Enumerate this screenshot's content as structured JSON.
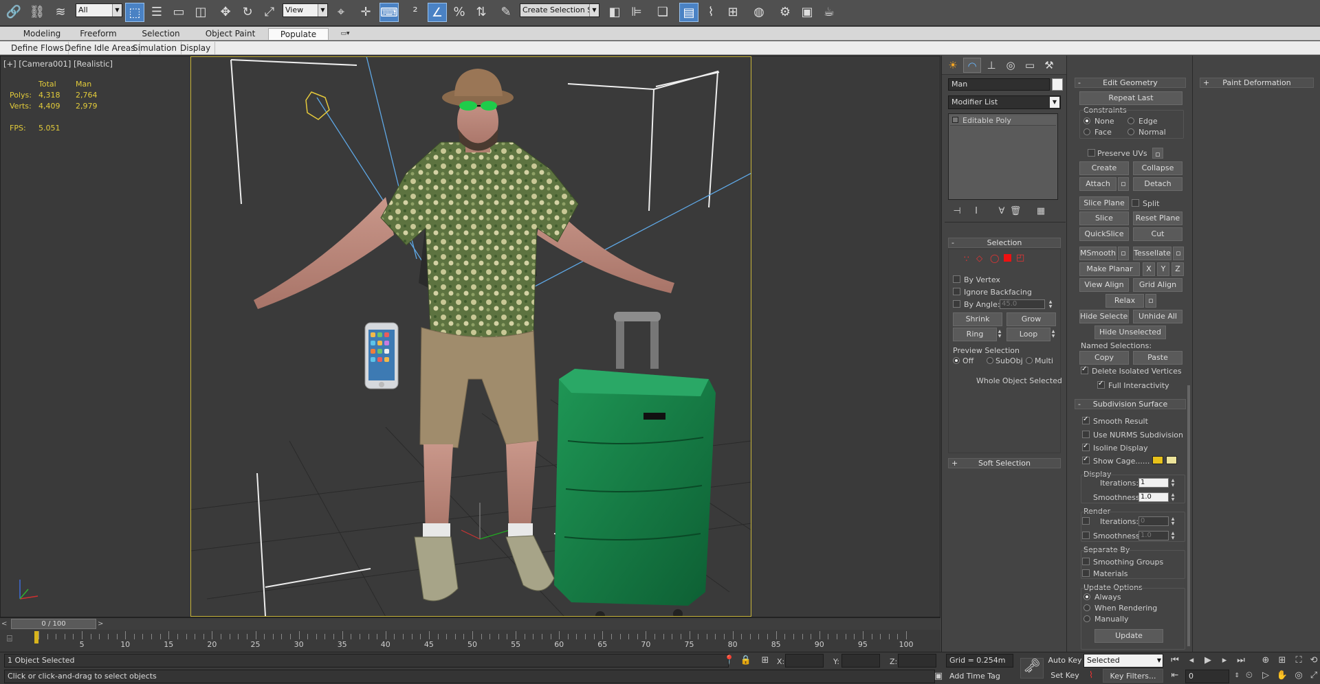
{
  "toolbar": {
    "selection_filter": "All",
    "ref_coord": "View",
    "named_selection_placeholder": "Create Selection Se",
    "colors": {
      "active": "#4a82c4",
      "bg": "#505050"
    }
  },
  "ribbon": {
    "tabs": [
      "Modeling",
      "Freeform",
      "Selection",
      "Object Paint",
      "Populate"
    ],
    "active_tab": "Populate",
    "subtabs": [
      "Define Flows",
      "Define Idle Areas",
      "Simulation",
      "Display"
    ]
  },
  "viewport": {
    "label": "[+] [Camera001] [Realistic]",
    "stats": {
      "col_total": "Total",
      "col_obj": "Man",
      "polys_label": "Polys:",
      "polys_total": "4,318",
      "polys_obj": "2,764",
      "verts_label": "Verts:",
      "verts_total": "4,409",
      "verts_obj": "2,979",
      "fps_label": "FPS:",
      "fps_value": "5.051"
    },
    "scene_objects": [
      "tourist-man-figure",
      "green-suitcase",
      "smartphone",
      "camera-frustum-lines",
      "ground-grid"
    ],
    "colors": {
      "frame": "#c8b53a",
      "stats": "#e3cc3a"
    }
  },
  "timeline": {
    "frame_display": "0 / 100",
    "ticks": [
      "5",
      "10",
      "15",
      "20",
      "25",
      "30",
      "35",
      "40",
      "45",
      "50",
      "55",
      "60",
      "65",
      "70",
      "75",
      "80",
      "85",
      "90",
      "95",
      "100"
    ]
  },
  "status": {
    "selected_text": "1 Object Selected",
    "prompt_text": "Click or click-and-drag to select objects",
    "x_label": "X:",
    "y_label": "Y:",
    "z_label": "Z:",
    "grid_text": "Grid = 0.254m",
    "add_time_tag": "Add Time Tag",
    "auto_key": "Auto Key",
    "set_key": "Set Key",
    "key_mode": "Selected",
    "key_filters": "Key Filters...",
    "frame_value": "0"
  },
  "command_panel": {
    "object_name": "Man",
    "modifier_list": "Modifier List",
    "stack_item": "Editable Poly",
    "selection": {
      "title": "Selection",
      "by_vertex": "By Vertex",
      "ignore_backfacing": "Ignore Backfacing",
      "by_angle": "By Angle:",
      "by_angle_value": "45.0",
      "shrink": "Shrink",
      "grow": "Grow",
      "ring": "Ring",
      "loop": "Loop",
      "preview_label": "Preview Selection",
      "preview_off": "Off",
      "preview_subobj": "SubObj",
      "preview_multi": "Multi",
      "whole_object": "Whole Object Selected"
    },
    "soft_selection": "Soft Selection"
  },
  "edit_geometry": {
    "title": "Edit Geometry",
    "repeat_last": "Repeat Last",
    "constraints": "Constraints",
    "none": "None",
    "edge": "Edge",
    "face": "Face",
    "normal": "Normal",
    "preserve_uvs": "Preserve UVs",
    "create": "Create",
    "collapse": "Collapse",
    "attach": "Attach",
    "detach": "Detach",
    "slice_plane": "Slice Plane",
    "split": "Split",
    "slice": "Slice",
    "reset_plane": "Reset Plane",
    "quickslice": "QuickSlice",
    "cut": "Cut",
    "msmooth": "MSmooth",
    "tessellate": "Tessellate",
    "make_planar": "Make Planar",
    "x": "X",
    "y": "Y",
    "z": "Z",
    "view_align": "View Align",
    "grid_align": "Grid Align",
    "relax": "Relax",
    "hide_selected": "Hide Selected",
    "unhide_all": "Unhide All",
    "hide_unselected": "Hide Unselected",
    "named_selections": "Named Selections:",
    "copy": "Copy",
    "paste": "Paste",
    "delete_isolated": "Delete Isolated Vertices",
    "full_interactivity": "Full Interactivity"
  },
  "subdivision": {
    "title": "Subdivision Surface",
    "smooth_result": "Smooth Result",
    "use_nurms": "Use NURMS Subdivision",
    "isoline_display": "Isoline Display",
    "show_cage": "Show Cage......",
    "display_label": "Display",
    "iterations_label": "Iterations:",
    "iterations_value": "1",
    "smoothness_label": "Smoothness:",
    "smoothness_value": "1.0",
    "render_label": "Render",
    "render_iterations_value": "0",
    "render_smoothness_value": "1.0",
    "separate_by": "Separate By",
    "smoothing_groups": "Smoothing Groups",
    "materials": "Materials",
    "update_options": "Update Options",
    "always": "Always",
    "when_rendering": "When Rendering",
    "manually": "Manually",
    "update": "Update",
    "cage_colors": [
      "#e8c21a",
      "#ece39a"
    ]
  },
  "paint_deformation": {
    "title": "Paint Deformation"
  }
}
